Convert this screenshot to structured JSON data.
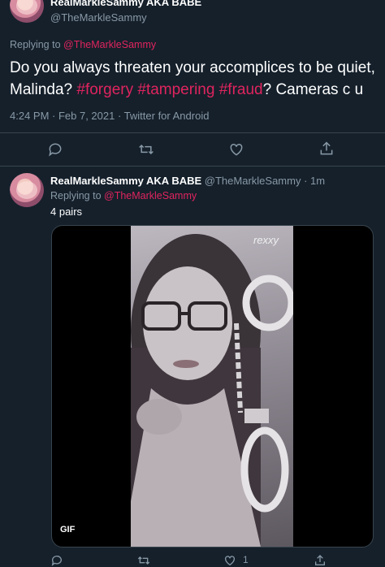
{
  "focused_tweet": {
    "display_name": "RealMarkleSammy AKA BABE",
    "handle": "@TheMarkleSammy",
    "replying_prefix": "Replying to ",
    "replying_to": "@TheMarkleSammy",
    "text_before": "Do you always threaten your accomplices to be quiet, Malinda? ",
    "hashtags": [
      "#forgery",
      "#tampering",
      "#fraud"
    ],
    "text_after": "? Cameras c u",
    "timestamp": "4:24 PM · Feb 7, 2021 · Twitter for Android"
  },
  "reply_tweet": {
    "display_name": "RealMarkleSammy AKA BABE",
    "handle": "@TheMarkleSammy",
    "time_ago": "· 1m",
    "replying_prefix": "Replying to ",
    "replying_to": "@TheMarkleSammy",
    "text": "4 pairs",
    "media_badge": "GIF",
    "watermark": "rexxy",
    "like_count": "1"
  },
  "icons": [
    "reply-icon",
    "retweet-icon",
    "like-icon",
    "share-icon"
  ],
  "colors": {
    "background": "#15202b",
    "accent": "#e0245e",
    "muted": "#8899a6",
    "divider": "#38444d"
  }
}
